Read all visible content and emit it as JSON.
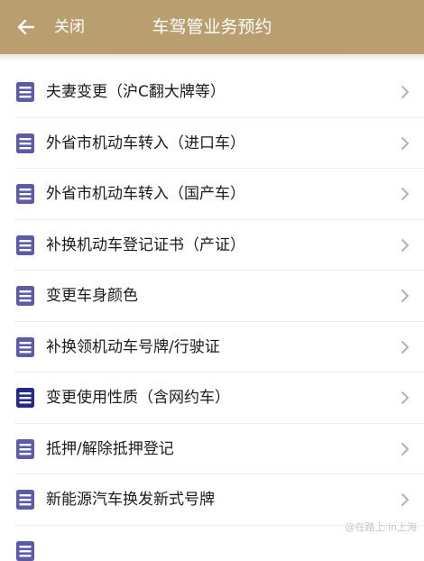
{
  "colors": {
    "header_bg": "#b99f6f",
    "icon_color": "#5b5ba8",
    "icon_color_dark": "#232a85"
  },
  "header": {
    "back_icon": "arrow-left-icon",
    "close_label": "关闭",
    "title": "车驾管业务预约"
  },
  "list": {
    "item_icon": "document-icon",
    "chevron_icon": "chevron-right-icon",
    "items": [
      {
        "label": "夫妻变更（沪C翻大牌等）"
      },
      {
        "label": "外省市机动车转入（进口车）"
      },
      {
        "label": "外省市机动车转入（国产车）"
      },
      {
        "label": "补换机动车登记证书（产证）"
      },
      {
        "label": "变更车身颜色"
      },
      {
        "label": "补换领机动车号牌/行驶证"
      },
      {
        "label": "变更使用性质（含网约车）"
      },
      {
        "label": "抵押/解除抵押登记"
      },
      {
        "label": "新能源汽车换发新式号牌"
      }
    ]
  },
  "watermark": "@在路上 in上海"
}
